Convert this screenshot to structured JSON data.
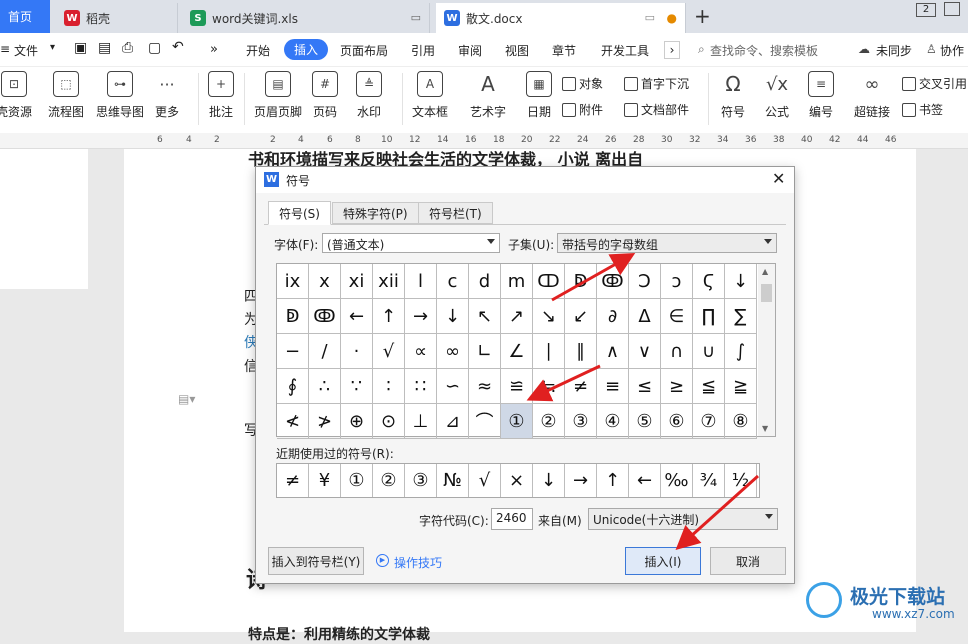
{
  "tabs": [
    {
      "label": "首页"
    },
    {
      "label": "稻壳",
      "icon_text": "W",
      "color": "#d9202f"
    },
    {
      "label": "word关键词.xls",
      "icon_text": "S",
      "color": "#1d9a58"
    },
    {
      "label": "散文.docx",
      "icon_text": "W",
      "color": "#2d6ee0"
    }
  ],
  "tab_add": "+",
  "window_badge": "2",
  "menu": {
    "file": "文件",
    "items": [
      "开始",
      "插入",
      "页面布局",
      "引用",
      "审阅",
      "视图",
      "章节",
      "开发工具"
    ],
    "active_index": 1,
    "search_placeholder": "查找命令、搜索模板",
    "sync": "未同步",
    "collab": "协作"
  },
  "ribbon": {
    "big": [
      "壳资源",
      "流程图",
      "思维导图",
      "更多",
      "批注",
      "页眉页脚",
      "页码",
      "水印",
      "文本框",
      "艺术字",
      "日期",
      "符号",
      "公式",
      "编号",
      "超链接"
    ],
    "small": [
      "对象",
      "附件",
      "首字下沉",
      "文档部件",
      "交叉引用",
      "书签"
    ]
  },
  "ruler": [
    "6",
    "4",
    "2",
    "2",
    "4",
    "6",
    "8",
    "10",
    "12",
    "14",
    "16",
    "18",
    "20",
    "22",
    "24",
    "26",
    "28",
    "30",
    "32",
    "34",
    "36",
    "38",
    "40",
    "42",
    "44",
    "46"
  ],
  "doc": {
    "line1": "书和环境描写来反映社会生活的文学体裁， 小说     离出自",
    "side_chars": [
      "四",
      "为",
      "侠",
      "信",
      "写",
      "诗"
    ],
    "heading": "诗",
    "bottom_line": "特点是：利用精练的文学体裁"
  },
  "dialog": {
    "title": "符号",
    "tabs": [
      "符号(S)",
      "特殊字符(P)",
      "符号栏(T)"
    ],
    "font_label": "字体(F):",
    "font_value": "(普通文本)",
    "subset_label": "子集(U):",
    "subset_value": "带括号的字母数组",
    "grid": [
      [
        "ix",
        "x",
        "xi",
        "xii",
        "l",
        "c",
        "d",
        "m",
        "ↀ",
        "ↁ",
        "ↂ",
        "Ↄ",
        "ↄ",
        "Ϛ",
        "↓"
      ],
      [
        "ↁ",
        "ↂ",
        "←",
        "↑",
        "→",
        "↓",
        "↖",
        "↗",
        "↘",
        "↙",
        "∂",
        "Δ",
        "∈",
        "∏",
        "∑"
      ],
      [
        "−",
        "/",
        "·",
        "√",
        "∝",
        "∞",
        "∟",
        "∠",
        "∣",
        "∥",
        "∧",
        "∨",
        "∩",
        "∪",
        "∫"
      ],
      [
        "∮",
        "∴",
        "∵",
        "∶",
        "∷",
        "∽",
        "≈",
        "≌",
        "≒",
        "≠",
        "≡",
        "≤",
        "≥",
        "≦",
        "≧"
      ],
      [
        "≮",
        "≯",
        "⊕",
        "⊙",
        "⊥",
        "⊿",
        "⌒",
        "①",
        "②",
        "③",
        "④",
        "⑤",
        "⑥",
        "⑦",
        "⑧"
      ]
    ],
    "selected": {
      "row": 4,
      "col": 7
    },
    "recent_label": "近期使用过的符号(R):",
    "recent": [
      "≠",
      "¥",
      "①",
      "②",
      "③",
      "№",
      "√",
      "×",
      "↓",
      "→",
      "↑",
      "←",
      "‰",
      "¾",
      "½"
    ],
    "code_label": "字符代码(C):",
    "code_value": "2460",
    "from_label": "来自(M)",
    "from_value": "Unicode(十六进制)",
    "insert_bar_button": "插入到符号栏(Y)",
    "tips_link": "操作技巧",
    "insert_button": "插入(I)",
    "cancel_button": "取消"
  },
  "watermark": {
    "title": "极光下载站",
    "url": "www.xz7.com"
  },
  "colors": {
    "accent": "#3478f6",
    "arrow": "#e02020"
  }
}
